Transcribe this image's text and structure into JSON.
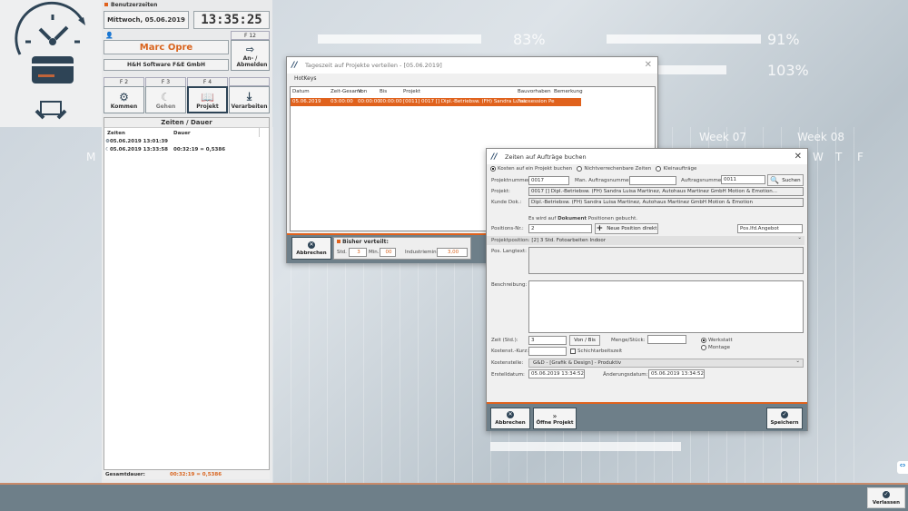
{
  "background": {
    "pct1": "83%",
    "pct2": "91%",
    "pct3": "103%",
    "week1": "Week 07",
    "week2": "Week 08",
    "days": [
      "W",
      "T",
      "F"
    ],
    "m": "M"
  },
  "colors": {
    "accent": "#e0621d",
    "bar": "#6e7f89",
    "icon": "#2e4456"
  },
  "side": {
    "header": "Benutzerzeiten",
    "date": "Mittwoch, 05.06.2019",
    "clock": "13:35:25",
    "user": "Marc Opre",
    "company": "H&H Software F&E GmbH",
    "f12": "F 12",
    "login_label": "An- / Abmelden",
    "keys": [
      {
        "key": "F 2",
        "label": "Kommen",
        "icon": "gear-icon"
      },
      {
        "key": "F 3",
        "label": "Gehen",
        "icon": "moon-icon"
      },
      {
        "key": "F 4",
        "label": "Projekt",
        "icon": "book-icon"
      },
      {
        "key": "",
        "label": "Verarbeiten",
        "icon": "download-icon"
      }
    ],
    "list_title": "Zeiten / Dauer",
    "col_times": "Zeiten",
    "col_duration": "Dauer",
    "rows": [
      {
        "time": "05.06.2019 13:01:39",
        "duration": "",
        "icon": "gear-icon"
      },
      {
        "time": "05.06.2019 13:33:58",
        "duration": "00:32:19 = 0,5386",
        "icon": "moon-icon"
      }
    ],
    "total_label": "Gesamtdauer:",
    "total_value": "00:32:19 = 0,5386"
  },
  "dialog1": {
    "title": "Tageszeit auf Projekte verteilen - [05.06.2019]",
    "menu": "HotKeys",
    "columns": [
      "Datum",
      "Zeit-Gesamt",
      "Von",
      "Bis",
      "Projekt",
      "Bauvorhaben",
      "Bemerkung"
    ],
    "rows": [
      [
        "05.06.2019",
        "03:00:00",
        "00:00:00",
        "00:00:00",
        "[0011] 0017 [] Dipl.-Betriebsw. (FH) Sandra Luisa",
        "Fotosession Pe",
        ""
      ]
    ],
    "cancel": "Abbrechen",
    "dist_title": "Bisher verteilt:",
    "std_label": "Std.",
    "std": "3",
    "min_label": "Min.",
    "min": "00",
    "ind_label": "Industriemin.",
    "ind": "3,00"
  },
  "dialog2": {
    "title": "Zeiten auf Aufträge buchen",
    "radios": [
      {
        "label": "Kosten auf ein Projekt buchen",
        "checked": true
      },
      {
        "label": "Nichtverrechenbare Zeiten",
        "checked": false
      },
      {
        "label": "Kleinaufträge",
        "checked": false
      }
    ],
    "projnr_label": "Projektnummer:",
    "projnr": "0017",
    "man_label": "Man. Auftragsnummer:",
    "man": "",
    "auftr_label": "Auftragsnummer:",
    "auftr": "0011",
    "search": "Suchen",
    "projekt_label": "Projekt:",
    "projekt": "0017 [] Dipl.-Betriebsw. (FH) Sandra Luisa Martinez, Autohaus Martinez GmbH Motion & Emotion...",
    "kunde_label": "Kunde Dok.:",
    "kunde": "Dipl.-Betriebsw. (FH) Sandra Luisa Martinez, Autohaus Martinez GmbH Motion & Emotion",
    "info1": "Es wird auf",
    "info2": "Dokument",
    "info3": "Positionen gebucht.",
    "posnr_label": "Positions-Nr.:",
    "posnr": "2",
    "newpos": "Neue Position direkt",
    "posangebot": "Pos.lfd.Angebot",
    "projpos_label": "Projektposition:",
    "projpos": "[2] 3 Std. Fotoarbeiten Indoor",
    "lang_label": "Pos. Langtext:",
    "besch_label": "Beschreibung:",
    "zeit_label": "Zeit (Std.):",
    "zeit": "3",
    "vonbis": "Von / Bis",
    "menge_label": "Menge/Stück:",
    "menge": "",
    "werk": "Werkstatt",
    "montage": "Montage",
    "kurz_label": "Kostenst.-Kurz:",
    "kurz": "",
    "schicht": "Schichtarbeitszeit",
    "kst_label": "Kostenstelle:",
    "kst": "G&D - [Grafik & Design]  - Produktiv",
    "erst_label": "Erstelldatum:",
    "erst": "05.06.2019 13:34:52",
    "aend_label": "Änderungsdatum:",
    "aend": "05.06.2019 13:34:52",
    "cancel": "Abbrechen",
    "open": "Öffne Projekt",
    "save": "Speichern"
  },
  "footer": {
    "exit": "Verlassen"
  }
}
